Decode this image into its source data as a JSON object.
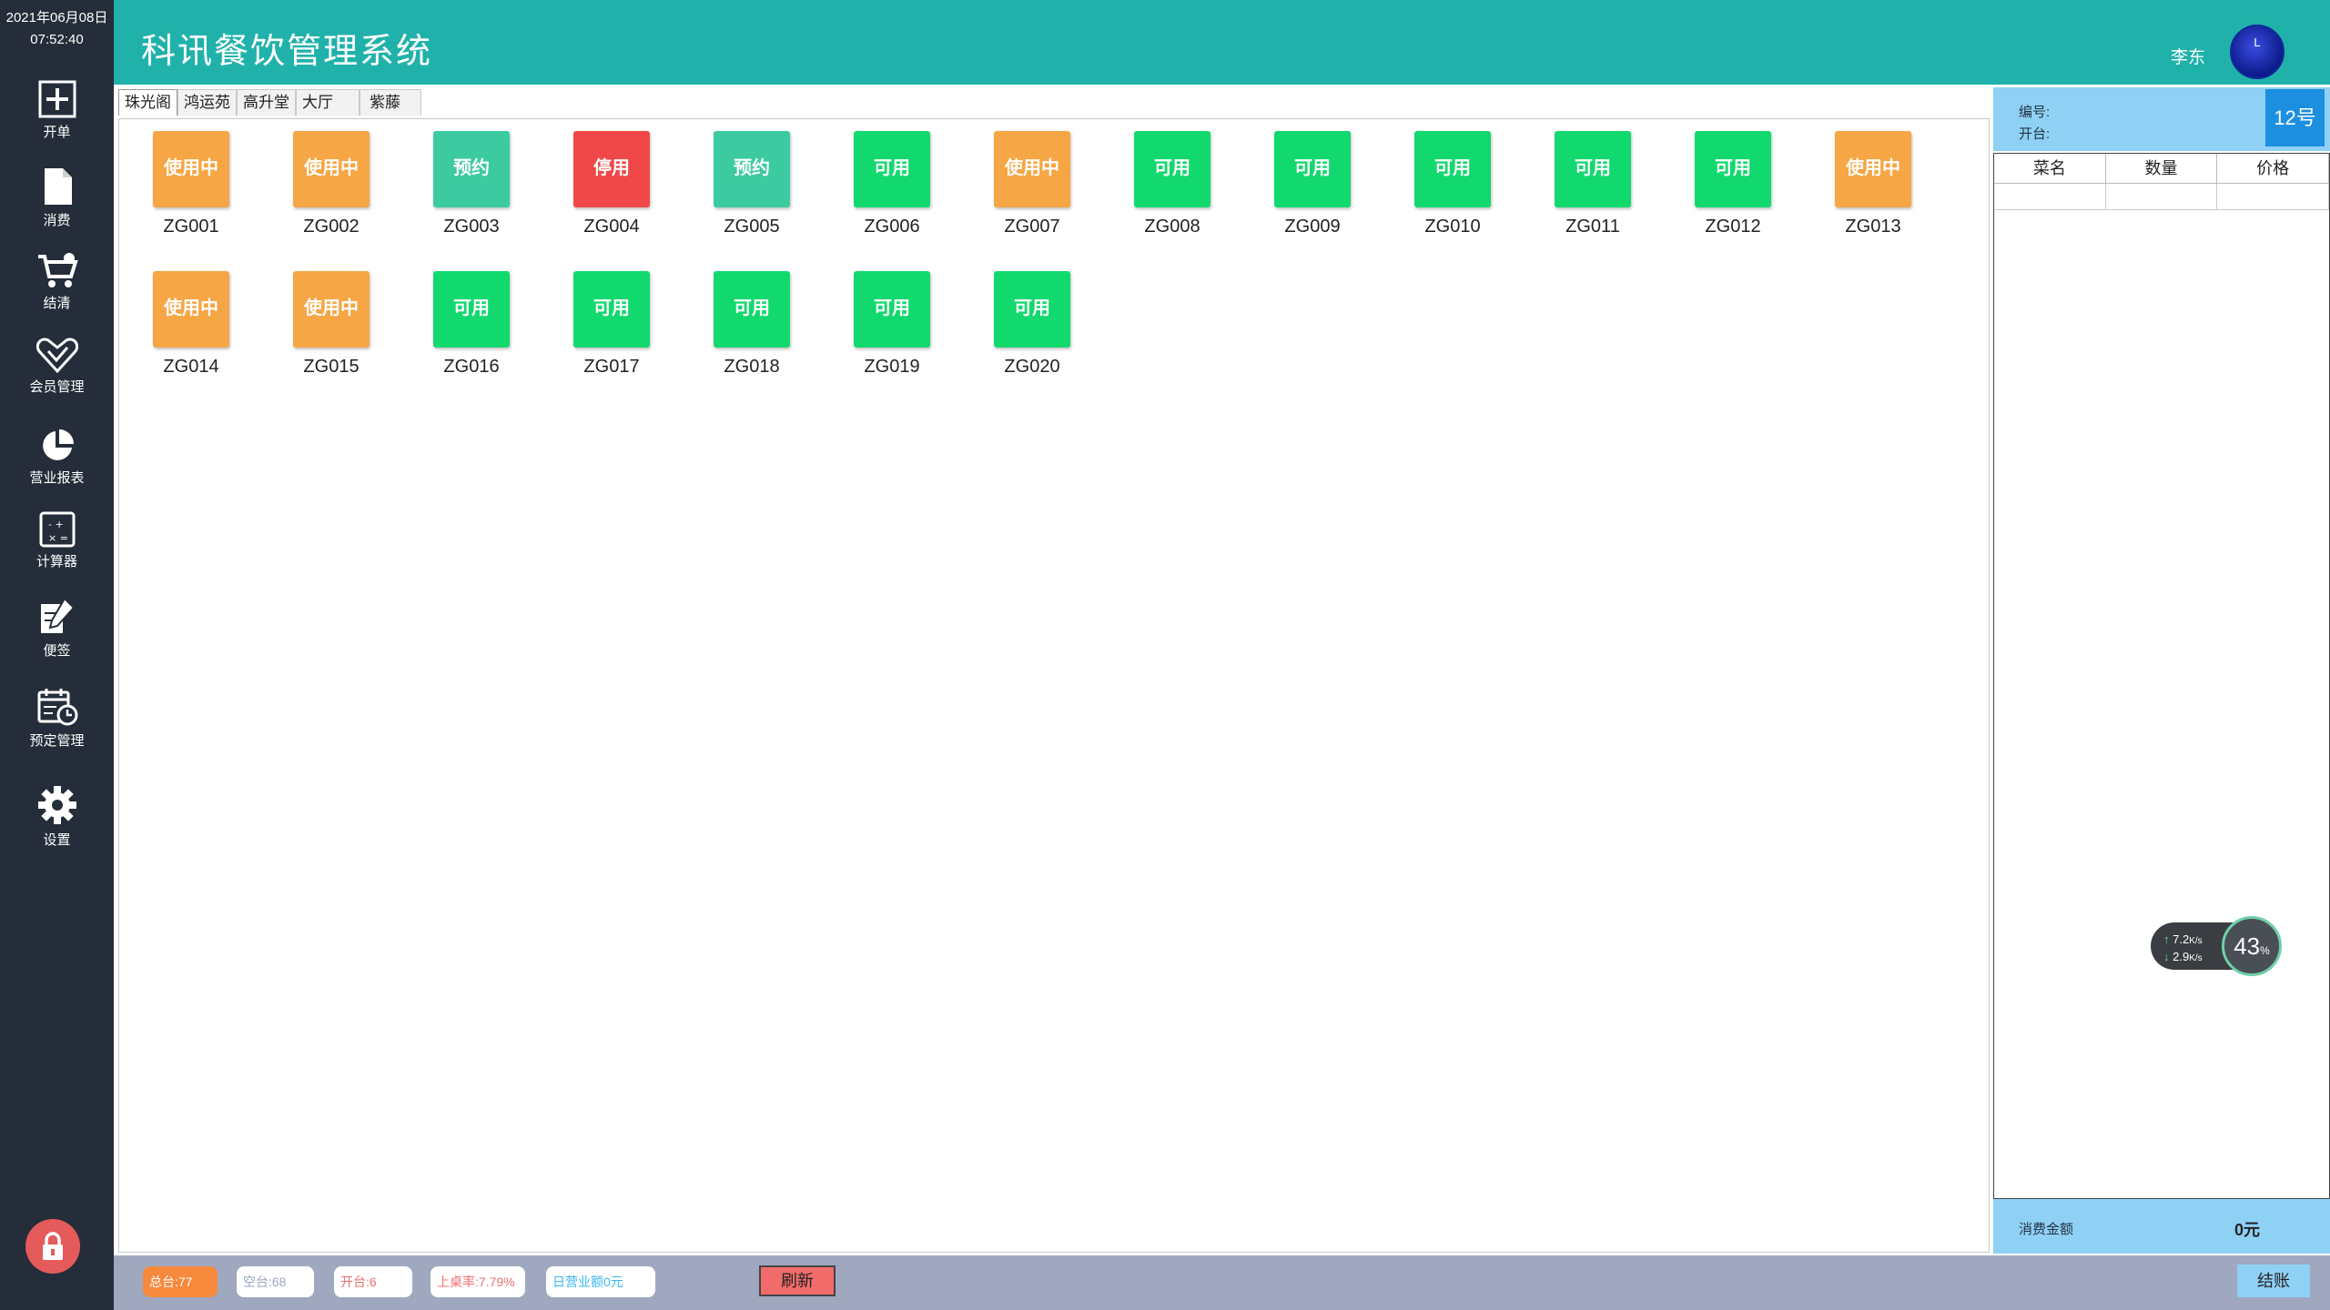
{
  "clock": {
    "date": "2021年06月08日",
    "time": "07:52:40"
  },
  "sidebar": {
    "items": [
      {
        "label": "开单",
        "icon": "plus-icon"
      },
      {
        "label": "消费",
        "icon": "document-icon"
      },
      {
        "label": "结清",
        "icon": "cart-icon"
      },
      {
        "label": "会员管理",
        "icon": "heart-check-icon"
      },
      {
        "label": "营业报表",
        "icon": "pie-chart-icon"
      },
      {
        "label": "计算器",
        "icon": "calculator-icon"
      },
      {
        "label": "便签",
        "icon": "note-icon"
      },
      {
        "label": "预定管理",
        "icon": "calendar-clock-icon"
      },
      {
        "label": "设置",
        "icon": "gear-icon"
      }
    ],
    "lock_icon": "lock-icon"
  },
  "header": {
    "title": "科讯餐饮管理系统",
    "user": "李东",
    "avatar_text": "L"
  },
  "tabs": [
    "珠光阁",
    "鸿运苑",
    "高升堂",
    "大厅",
    "紫藤"
  ],
  "status_colors": {
    "使用中": "#f6a644",
    "预约": "#3ccba0",
    "停用": "#f04848",
    "可用": "#12d96e"
  },
  "tables": [
    {
      "code": "ZG001",
      "status": "使用中"
    },
    {
      "code": "ZG002",
      "status": "使用中"
    },
    {
      "code": "ZG003",
      "status": "预约"
    },
    {
      "code": "ZG004",
      "status": "停用"
    },
    {
      "code": "ZG005",
      "status": "预约"
    },
    {
      "code": "ZG006",
      "status": "可用"
    },
    {
      "code": "ZG007",
      "status": "使用中"
    },
    {
      "code": "ZG008",
      "status": "可用"
    },
    {
      "code": "ZG009",
      "status": "可用"
    },
    {
      "code": "ZG010",
      "status": "可用"
    },
    {
      "code": "ZG011",
      "status": "可用"
    },
    {
      "code": "ZG012",
      "status": "可用"
    },
    {
      "code": "ZG013",
      "status": "使用中"
    },
    {
      "code": "ZG014",
      "status": "使用中"
    },
    {
      "code": "ZG015",
      "status": "使用中"
    },
    {
      "code": "ZG016",
      "status": "可用"
    },
    {
      "code": "ZG017",
      "status": "可用"
    },
    {
      "code": "ZG018",
      "status": "可用"
    },
    {
      "code": "ZG019",
      "status": "可用"
    },
    {
      "code": "ZG020",
      "status": "可用"
    }
  ],
  "right_panel": {
    "number_label": "编号:",
    "open_label": "开台:",
    "table_number": "12号",
    "columns": [
      "菜名",
      "数量",
      "价格"
    ],
    "total_label": "消费金额",
    "total_value": "0元"
  },
  "net_widget": {
    "upload": "7.2",
    "download": "2.9",
    "unit": "K/s",
    "percent": "43",
    "percent_unit": "%"
  },
  "status_bar": {
    "total": "总台:77",
    "empty": "空台:68",
    "open": "开台:6",
    "rate": "上桌率:7.79%",
    "revenue": "日营业额0元",
    "refresh": "刷新",
    "checkout": "结账"
  }
}
